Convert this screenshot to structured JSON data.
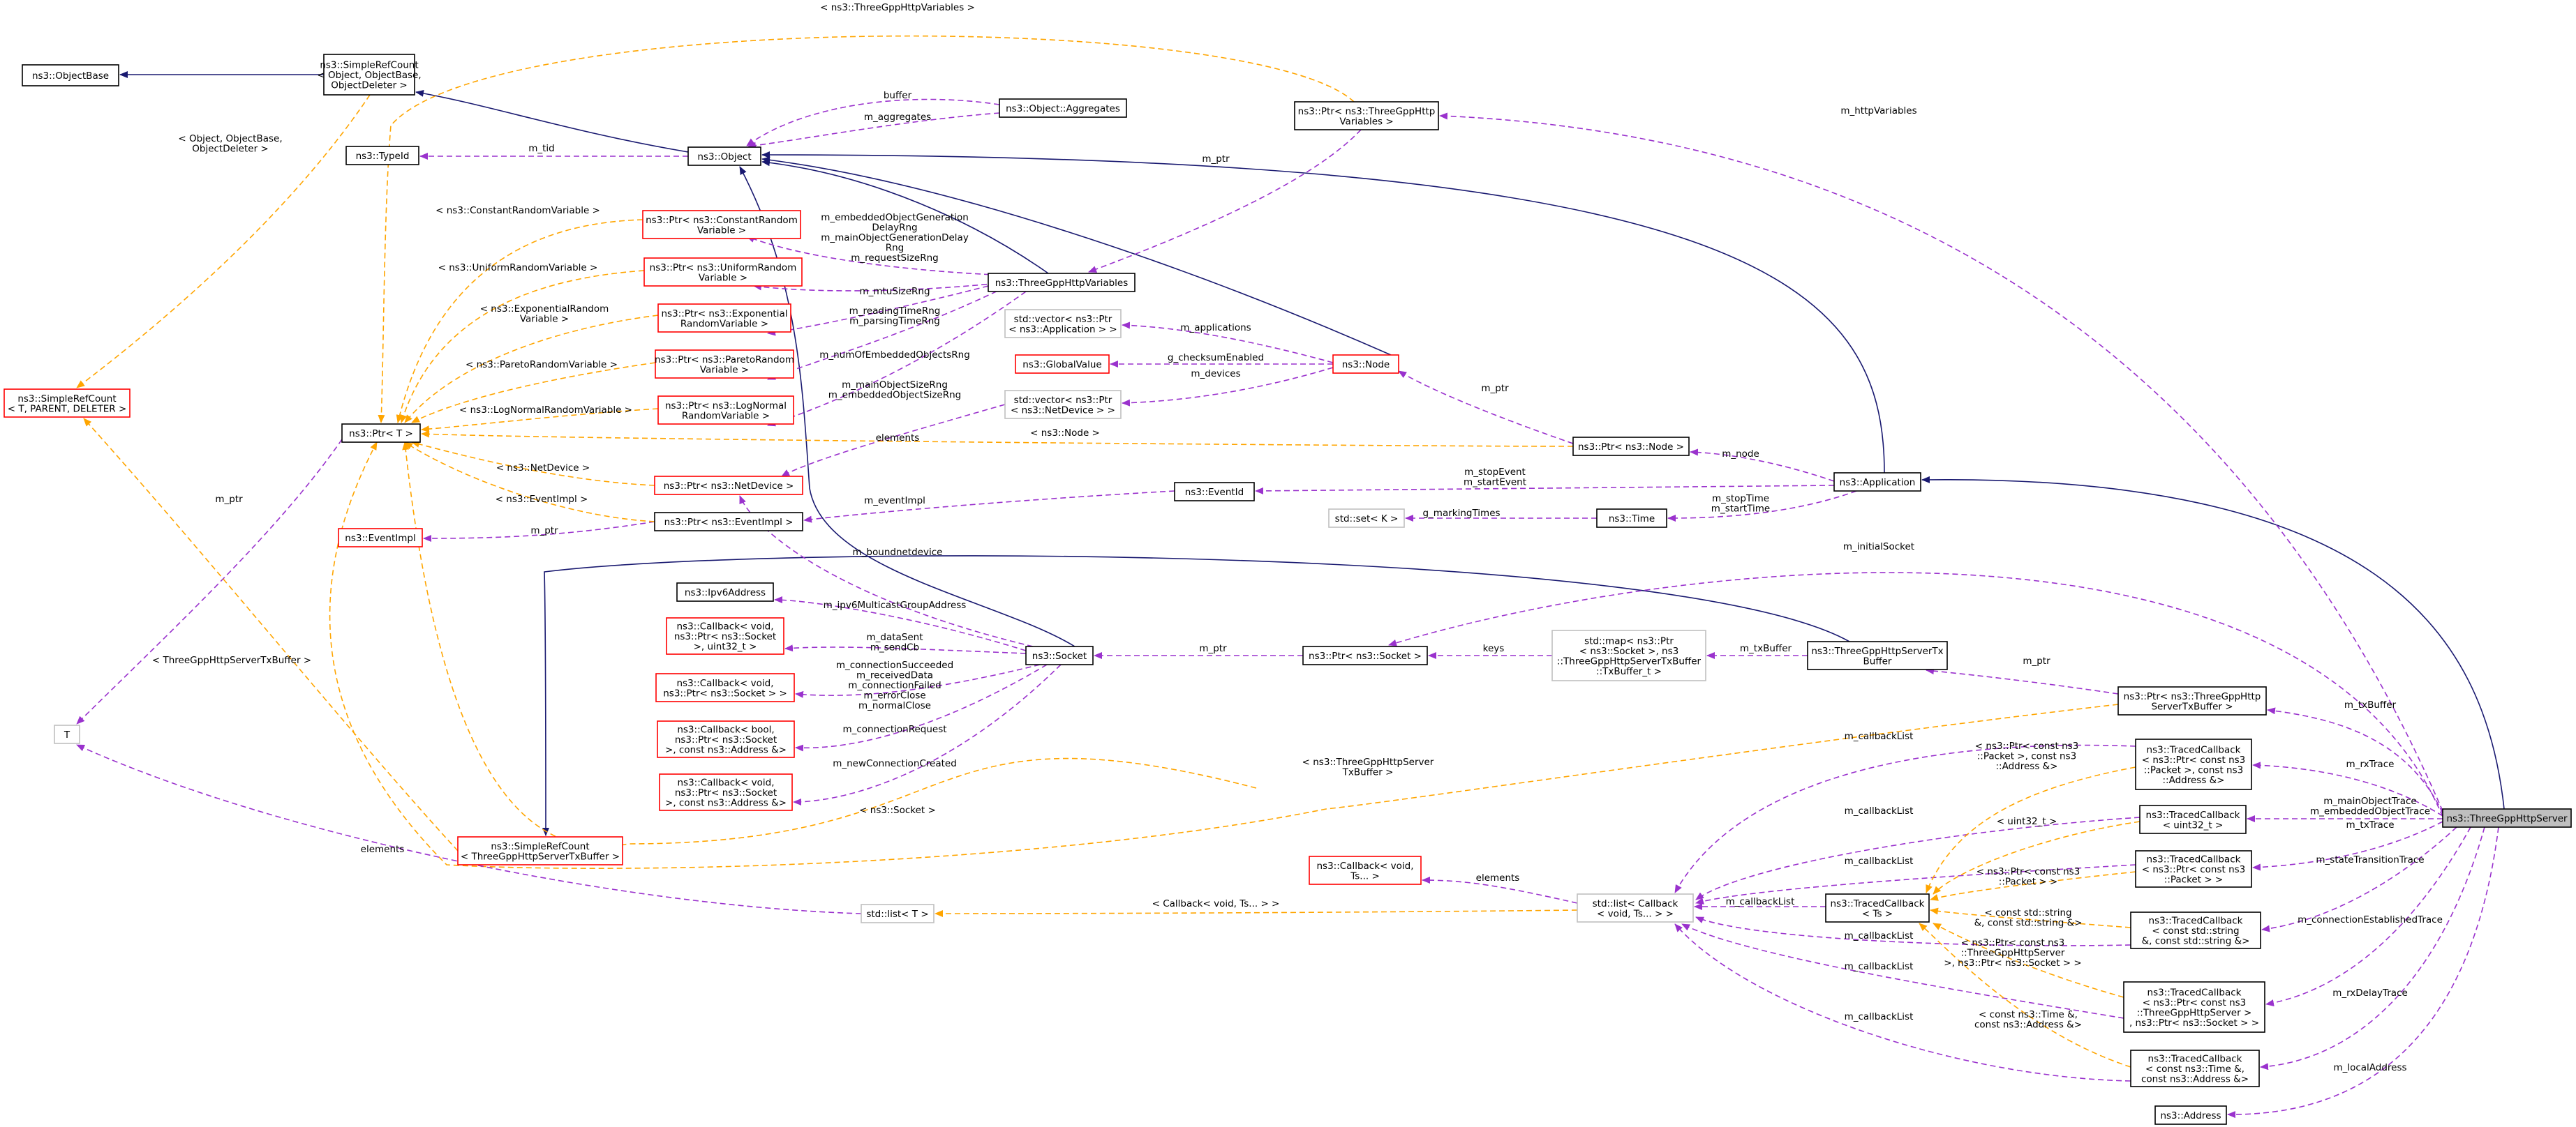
{
  "colors": {
    "inherit": "#191970",
    "usage": "#9a32cd",
    "template": "#ffa500",
    "node_border": "#000000",
    "node_border_incomplete": "#ff0000",
    "node_border_undocumented": "#bfbfbf",
    "highlight_fill": "#bfbfbf"
  },
  "nodes": [
    {
      "id": "objbase",
      "lines": [
        "ns3::ObjectBase"
      ],
      "border": "black"
    },
    {
      "id": "simplerefcount_obj",
      "lines": [
        "ns3::SimpleRefCount",
        "< Object, ObjectBase,",
        "ObjectDeleter >"
      ],
      "border": "black"
    },
    {
      "id": "typeid",
      "lines": [
        "ns3::TypeId"
      ],
      "border": "black"
    },
    {
      "id": "object",
      "lines": [
        "ns3::Object"
      ],
      "border": "black"
    },
    {
      "id": "aggregates",
      "lines": [
        "ns3::Object::Aggregates"
      ],
      "border": "black"
    },
    {
      "id": "ptr_vars",
      "lines": [
        "ns3::Ptr< ns3::ThreeGppHttp",
        "Variables >"
      ],
      "border": "black"
    },
    {
      "id": "simplerefcount_t",
      "lines": [
        "ns3::SimpleRefCount",
        "< T, PARENT, DELETER >"
      ],
      "border": "red"
    },
    {
      "id": "ptr_t",
      "lines": [
        "ns3::Ptr< T >"
      ],
      "border": "black"
    },
    {
      "id": "ptr_const_rv",
      "lines": [
        "ns3::Ptr< ns3::ConstantRandom",
        "Variable >"
      ],
      "border": "red"
    },
    {
      "id": "ptr_uni_rv",
      "lines": [
        "ns3::Ptr< ns3::UniformRandom",
        "Variable >"
      ],
      "border": "red"
    },
    {
      "id": "ptr_exp_rv",
      "lines": [
        "ns3::Ptr< ns3::Exponential",
        "RandomVariable >"
      ],
      "border": "red"
    },
    {
      "id": "ptr_par_rv",
      "lines": [
        "ns3::Ptr< ns3::ParetoRandom",
        "Variable >"
      ],
      "border": "red"
    },
    {
      "id": "ptr_log_rv",
      "lines": [
        "ns3::Ptr< ns3::LogNormal",
        "RandomVariable >"
      ],
      "border": "red"
    },
    {
      "id": "ptr_netdev",
      "lines": [
        "ns3::Ptr< ns3::NetDevice >"
      ],
      "border": "red"
    },
    {
      "id": "ptr_eventimpl",
      "lines": [
        "ns3::Ptr< ns3::EventImpl >"
      ],
      "border": "black"
    },
    {
      "id": "eventimpl",
      "lines": [
        "ns3::EventImpl"
      ],
      "border": "red"
    },
    {
      "id": "ipv6addr",
      "lines": [
        "ns3::Ipv6Address"
      ],
      "border": "black"
    },
    {
      "id": "cb_uint32",
      "lines": [
        "ns3::Callback< void,",
        "ns3::Ptr< ns3::Socket",
        ">, uint32_t >"
      ],
      "border": "red"
    },
    {
      "id": "cb_socket",
      "lines": [
        "ns3::Callback< void,",
        "ns3::Ptr< ns3::Socket > >"
      ],
      "border": "red"
    },
    {
      "id": "cb_bool",
      "lines": [
        "ns3::Callback< bool,",
        "ns3::Ptr< ns3::Socket",
        ">, const ns3::Address &>"
      ],
      "border": "red"
    },
    {
      "id": "cb_void_addr",
      "lines": [
        "ns3::Callback< void,",
        "ns3::Ptr< ns3::Socket",
        ">, const ns3::Address &>"
      ],
      "border": "red"
    },
    {
      "id": "t",
      "lines": [
        "T"
      ],
      "border": "gray"
    },
    {
      "id": "srefcount_txbuf",
      "lines": [
        "ns3::SimpleRefCount",
        "< ThreeGppHttpServerTxBuffer >"
      ],
      "border": "red"
    },
    {
      "id": "gppvars",
      "lines": [
        "ns3::ThreeGppHttpVariables"
      ],
      "border": "black"
    },
    {
      "id": "vec_app",
      "lines": [
        "std::vector< ns3::Ptr",
        "< ns3::Application > >"
      ],
      "border": "gray"
    },
    {
      "id": "globalvalue",
      "lines": [
        "ns3::GlobalValue"
      ],
      "border": "red"
    },
    {
      "id": "vec_netdev",
      "lines": [
        "std::vector< ns3::Ptr",
        "< ns3::NetDevice > >"
      ],
      "border": "gray"
    },
    {
      "id": "node",
      "lines": [
        "ns3::Node"
      ],
      "border": "red"
    },
    {
      "id": "ptr_node",
      "lines": [
        "ns3::Ptr< ns3::Node >"
      ],
      "border": "black"
    },
    {
      "id": "eventid",
      "lines": [
        "ns3::EventId"
      ],
      "border": "black"
    },
    {
      "id": "application",
      "lines": [
        "ns3::Application"
      ],
      "border": "black"
    },
    {
      "id": "set_k",
      "lines": [
        "std::set< K >"
      ],
      "border": "gray"
    },
    {
      "id": "time",
      "lines": [
        "ns3::Time"
      ],
      "border": "black"
    },
    {
      "id": "socket",
      "lines": [
        "ns3::Socket"
      ],
      "border": "black"
    },
    {
      "id": "ptr_socket",
      "lines": [
        "ns3::Ptr< ns3::Socket >"
      ],
      "border": "black"
    },
    {
      "id": "map_txbuf",
      "lines": [
        "std::map< ns3::Ptr",
        "< ns3::Socket >, ns3",
        "::ThreeGppHttpServerTxBuffer",
        "::TxBuffer_t >"
      ],
      "border": "gray"
    },
    {
      "id": "txbuffer",
      "lines": [
        "ns3::ThreeGppHttpServerTx",
        "Buffer"
      ],
      "border": "black"
    },
    {
      "id": "ptr_txbuffer",
      "lines": [
        "ns3::Ptr< ns3::ThreeGppHttp",
        "ServerTxBuffer >"
      ],
      "border": "black"
    },
    {
      "id": "cb_void_ts",
      "lines": [
        "ns3::Callback< void,",
        "Ts... >"
      ],
      "border": "red"
    },
    {
      "id": "list_t",
      "lines": [
        "std::list< T >"
      ],
      "border": "gray"
    },
    {
      "id": "list_cb",
      "lines": [
        "std::list< Callback",
        "< void, Ts... > >"
      ],
      "border": "gray"
    },
    {
      "id": "tcb_ts",
      "lines": [
        "ns3::TracedCallback",
        "< Ts >"
      ],
      "border": "black"
    },
    {
      "id": "tcb_pkt_addr",
      "lines": [
        "ns3::TracedCallback",
        "< ns3::Ptr< const ns3",
        "::Packet >, const ns3",
        "::Address &>"
      ],
      "border": "black"
    },
    {
      "id": "tcb_uint32",
      "lines": [
        "ns3::TracedCallback",
        "< uint32_t >"
      ],
      "border": "black"
    },
    {
      "id": "tcb_pkt",
      "lines": [
        "ns3::TracedCallback",
        "< ns3::Ptr< const ns3",
        "::Packet > >"
      ],
      "border": "black"
    },
    {
      "id": "tcb_str",
      "lines": [
        "ns3::TracedCallback",
        "< const std::string",
        "&, const std::string &>"
      ],
      "border": "black"
    },
    {
      "id": "tcb_server",
      "lines": [
        "ns3::TracedCallback",
        "< ns3::Ptr< const ns3",
        "::ThreeGppHttpServer >",
        ", ns3::Ptr< ns3::Socket > >"
      ],
      "border": "black"
    },
    {
      "id": "tcb_time",
      "lines": [
        "ns3::TracedCallback",
        "< const ns3::Time &,",
        "const ns3::Address &>"
      ],
      "border": "black"
    },
    {
      "id": "address",
      "lines": [
        "ns3::Address"
      ],
      "border": "black"
    },
    {
      "id": "server",
      "lines": [
        "ns3::ThreeGppHttpServer"
      ],
      "border": "black",
      "highlight": true
    }
  ],
  "edge_labels": [
    {
      "id": "l_tgvars",
      "text": "< ns3::ThreeGppHttpVariables >",
      "kind": "template"
    },
    {
      "id": "l_objbase_tpl",
      "lines": [
        "< Object, ObjectBase,",
        "ObjectDeleter >"
      ],
      "kind": "template"
    },
    {
      "id": "l_buffer",
      "text": "buffer",
      "kind": "usage"
    },
    {
      "id": "l_aggregates",
      "text": "m_aggregates",
      "kind": "usage"
    },
    {
      "id": "l_tid",
      "text": "m_tid",
      "kind": "usage"
    },
    {
      "id": "l_mptr_vars",
      "text": "m_ptr",
      "kind": "usage"
    },
    {
      "id": "l_httpvars",
      "text": "m_httpVariables",
      "kind": "usage"
    },
    {
      "id": "l_const_rv",
      "text": "< ns3::ConstantRandomVariable >",
      "kind": "template"
    },
    {
      "id": "l_uni_rv",
      "text": "< ns3::UniformRandomVariable >",
      "kind": "template"
    },
    {
      "id": "l_exp_rv",
      "lines": [
        "< ns3::ExponentialRandom",
        "Variable >"
      ],
      "kind": "template"
    },
    {
      "id": "l_par_rv",
      "text": "< ns3::ParetoRandomVariable >",
      "kind": "template"
    },
    {
      "id": "l_log_rv",
      "text": "< ns3::LogNormalRandomVariable >",
      "kind": "template"
    },
    {
      "id": "l_netdev_tpl",
      "text": "< ns3::NetDevice >",
      "kind": "template"
    },
    {
      "id": "l_eventimpl_tpl",
      "text": "< ns3::EventImpl >",
      "kind": "template"
    },
    {
      "id": "l_mptr_eventimpl",
      "text": "m_ptr",
      "kind": "usage"
    },
    {
      "id": "l_mptr_t",
      "text": "m_ptr",
      "kind": "usage"
    },
    {
      "id": "l_txbuf_tpl",
      "text": "< ThreeGppHttpServerTxBuffer >",
      "kind": "template"
    },
    {
      "id": "l_elements_t",
      "text": "elements",
      "kind": "usage"
    },
    {
      "id": "l_rng_group",
      "lines": [
        "m_embeddedObjectGeneration",
        "DelayRng",
        "m_mainObjectGenerationDelay",
        "Rng",
        "m_requestSizeRng"
      ],
      "kind": "usage"
    },
    {
      "id": "l_mtu",
      "text": "m_mtuSizeRng",
      "kind": "usage"
    },
    {
      "id": "l_reading",
      "lines": [
        "m_readingTimeRng",
        "m_parsingTimeRng"
      ],
      "kind": "usage"
    },
    {
      "id": "l_numemb",
      "text": "m_numOfEmbeddedObjectsRng",
      "kind": "usage"
    },
    {
      "id": "l_mainsize",
      "lines": [
        "m_mainObjectSizeRng",
        "m_embeddedObjectSizeRng"
      ],
      "kind": "usage"
    },
    {
      "id": "l_elements_nd",
      "text": "elements",
      "kind": "usage"
    },
    {
      "id": "l_nodevec_tpl",
      "text": "< ns3::Node >",
      "kind": "template"
    },
    {
      "id": "l_applications",
      "text": "m_applications",
      "kind": "usage"
    },
    {
      "id": "l_checksum",
      "text": "g_checksumEnabled",
      "kind": "usage"
    },
    {
      "id": "l_devices",
      "text": "m_devices",
      "kind": "usage"
    },
    {
      "id": "l_mptr_node",
      "text": "m_ptr",
      "kind": "usage"
    },
    {
      "id": "l_mnode",
      "text": "m_node",
      "kind": "usage"
    },
    {
      "id": "l_eventimpl",
      "text": "m_eventImpl",
      "kind": "usage"
    },
    {
      "id": "l_stopevent",
      "lines": [
        "m_stopEvent",
        "m_startEvent"
      ],
      "kind": "usage"
    },
    {
      "id": "l_marking",
      "text": "g_markingTimes",
      "kind": "usage"
    },
    {
      "id": "l_stoptime",
      "lines": [
        "m_stopTime",
        "m_startTime"
      ],
      "kind": "usage"
    },
    {
      "id": "l_boundnet",
      "text": "m_boundnetdevice",
      "kind": "usage"
    },
    {
      "id": "l_initsock",
      "text": "m_initialSocket",
      "kind": "usage"
    },
    {
      "id": "l_ipv6mc",
      "text": "m_ipv6MulticastGroupAddress",
      "kind": "usage"
    },
    {
      "id": "l_datasent",
      "lines": [
        "m_dataSent",
        "m_sendCb"
      ],
      "kind": "usage"
    },
    {
      "id": "l_connsucc",
      "lines": [
        "m_connectionSucceeded",
        "m_receivedData",
        "m_connectionFailed",
        "m_errorClose",
        "m_normalClose"
      ],
      "kind": "usage"
    },
    {
      "id": "l_connreq",
      "text": "m_connectionRequest",
      "kind": "usage"
    },
    {
      "id": "l_newconn",
      "text": "m_newConnectionCreated",
      "kind": "usage"
    },
    {
      "id": "l_mptr_socket",
      "text": "m_ptr",
      "kind": "usage"
    },
    {
      "id": "l_keys",
      "text": "keys",
      "kind": "usage"
    },
    {
      "id": "l_txbuffer_map",
      "text": "m_txBuffer",
      "kind": "usage"
    },
    {
      "id": "l_mptr_txbuf",
      "text": "m_ptr",
      "kind": "usage"
    },
    {
      "id": "l_mtxbuffer",
      "text": "m_txBuffer",
      "kind": "usage"
    },
    {
      "id": "l_socket_tpl",
      "text": "< ns3::Socket >",
      "kind": "template"
    },
    {
      "id": "l_srv_txbuf_tpl",
      "lines": [
        "< ns3::ThreeGppHttpServer",
        "TxBuffer >"
      ],
      "kind": "template"
    },
    {
      "id": "l_elements_cb",
      "text": "elements",
      "kind": "usage"
    },
    {
      "id": "l_cb_tpl",
      "text": "< Callback< void, Ts... > >",
      "kind": "template"
    },
    {
      "id": "l_cblist_main",
      "text": "m_callbackList",
      "kind": "usage"
    },
    {
      "id": "l_cblist_1",
      "text": "m_callbackList",
      "kind": "usage"
    },
    {
      "id": "l_cblist_2",
      "text": "m_callbackList",
      "kind": "usage"
    },
    {
      "id": "l_cblist_3",
      "text": "m_callbackList",
      "kind": "usage"
    },
    {
      "id": "l_cblist_4",
      "text": "m_callbackList",
      "kind": "usage"
    },
    {
      "id": "l_cblist_5",
      "text": "m_callbackList",
      "kind": "usage"
    },
    {
      "id": "l_cblist_6",
      "text": "m_callbackList",
      "kind": "usage"
    },
    {
      "id": "l_tpl_pkt_addr",
      "lines": [
        "< ns3::Ptr< const ns3",
        "::Packet >, const ns3",
        "::Address &>"
      ],
      "kind": "template"
    },
    {
      "id": "l_tpl_uint32",
      "text": "< uint32_t >",
      "kind": "template"
    },
    {
      "id": "l_tpl_pkt",
      "lines": [
        "< ns3::Ptr< const ns3",
        "::Packet > >"
      ],
      "kind": "template"
    },
    {
      "id": "l_tpl_str",
      "lines": [
        "< const std::string",
        "&, const std::string &>"
      ],
      "kind": "template"
    },
    {
      "id": "l_tpl_server",
      "lines": [
        "< ns3::Ptr< const ns3",
        "::ThreeGppHttpServer",
        ">, ns3::Ptr< ns3::Socket > >"
      ],
      "kind": "template"
    },
    {
      "id": "l_tpl_time",
      "lines": [
        "< const ns3::Time &,",
        "const ns3::Address &>"
      ],
      "kind": "template"
    },
    {
      "id": "l_rxtrace",
      "text": "m_rxTrace",
      "kind": "usage"
    },
    {
      "id": "l_mainobjtrace",
      "lines": [
        "m_mainObjectTrace",
        "m_embeddedObjectTrace"
      ],
      "kind": "usage"
    },
    {
      "id": "l_txtrace",
      "text": "m_txTrace",
      "kind": "usage"
    },
    {
      "id": "l_statetrans",
      "text": "m_stateTransitionTrace",
      "kind": "usage"
    },
    {
      "id": "l_connest",
      "text": "m_connectionEstablishedTrace",
      "kind": "usage"
    },
    {
      "id": "l_rxdelay",
      "text": "m_rxDelayTrace",
      "kind": "usage"
    },
    {
      "id": "l_localaddr",
      "text": "m_localAddress",
      "kind": "usage"
    }
  ]
}
